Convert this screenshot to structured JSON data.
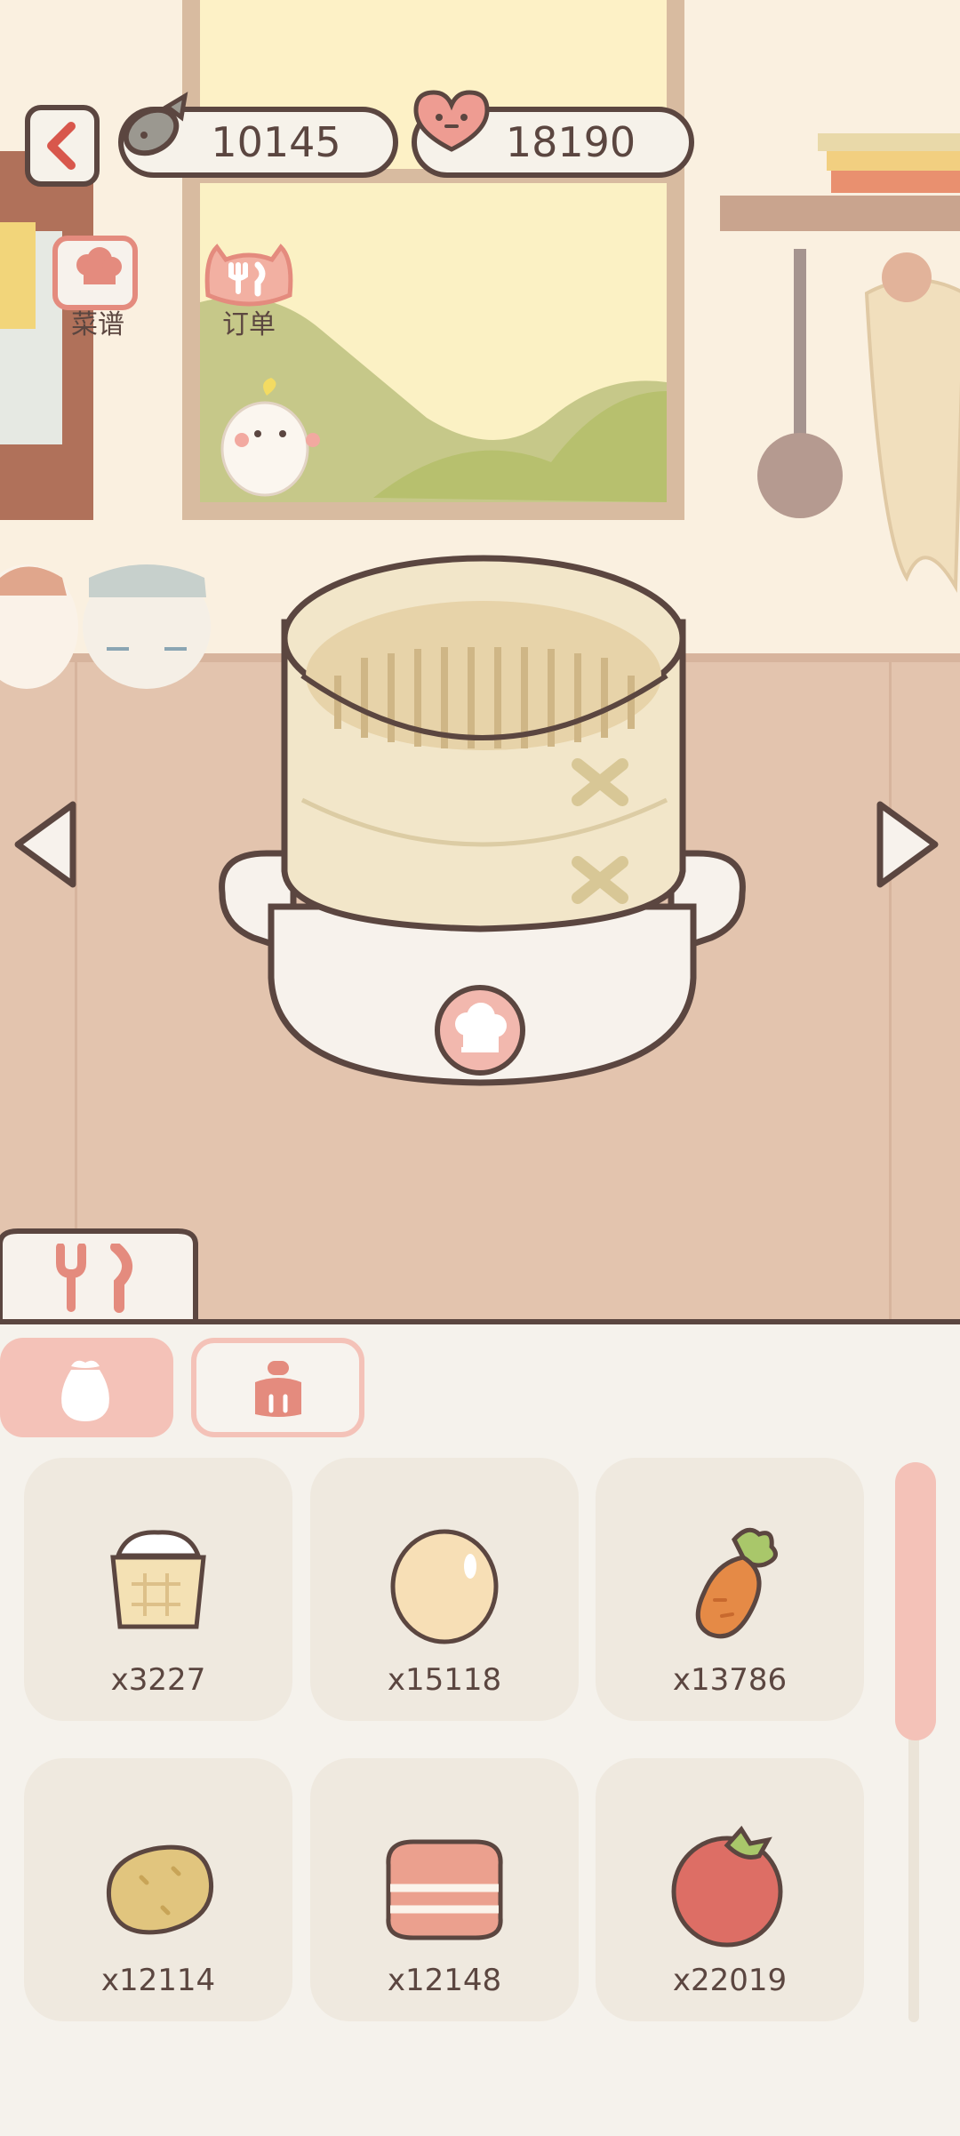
{
  "currency": {
    "fish": "10145",
    "hearts": "18190"
  },
  "shortcuts": {
    "recipes": "菜谱",
    "orders": "订单"
  },
  "ingredients": [
    {
      "icon": "flour-basket-icon",
      "count": "x3227"
    },
    {
      "icon": "egg-icon",
      "count": "x15118"
    },
    {
      "icon": "carrot-icon",
      "count": "x13786"
    },
    {
      "icon": "potato-icon",
      "count": "x12114"
    },
    {
      "icon": "bacon-icon",
      "count": "x12148"
    },
    {
      "icon": "tomato-icon",
      "count": "x22019"
    }
  ],
  "colors": {
    "accent": "#f2b8ae",
    "outline": "#5b4640",
    "wall": "#faf0e0",
    "counter": "#e3c4ae"
  }
}
